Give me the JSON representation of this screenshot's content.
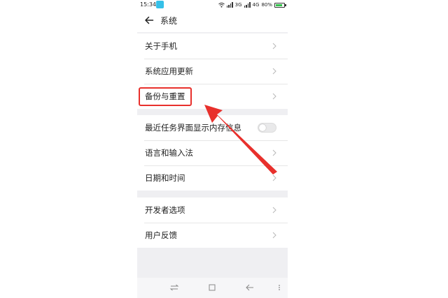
{
  "status_bar": {
    "time": "15:34",
    "network_1": "3G",
    "network_2": "4G",
    "battery": "80%",
    "battery_level": 0.8,
    "battery_color": "#33c04a"
  },
  "header": {
    "title": "系统",
    "back_icon": "arrow-left-icon"
  },
  "groups": [
    {
      "items": [
        {
          "label": "关于手机",
          "control": "chevron"
        },
        {
          "label": "系统应用更新",
          "control": "chevron"
        },
        {
          "label": "备份与重置",
          "control": "chevron",
          "highlighted": true
        }
      ]
    },
    {
      "items": [
        {
          "label": "最近任务界面显示内存信息",
          "control": "toggle",
          "toggle_on": false
        },
        {
          "label": "语言和输入法",
          "control": "chevron"
        },
        {
          "label": "日期和时间",
          "control": "chevron"
        }
      ]
    },
    {
      "items": [
        {
          "label": "开发者选项",
          "control": "chevron"
        },
        {
          "label": "用户反馈",
          "control": "chevron"
        }
      ]
    }
  ],
  "nav_bar": {
    "icons": [
      "switch-icon",
      "home-square-icon",
      "back-arrow-icon",
      "menu-dots-icon"
    ]
  },
  "annotation": {
    "highlight_color": "#e8302c",
    "arrow_color": "#e8302c"
  }
}
